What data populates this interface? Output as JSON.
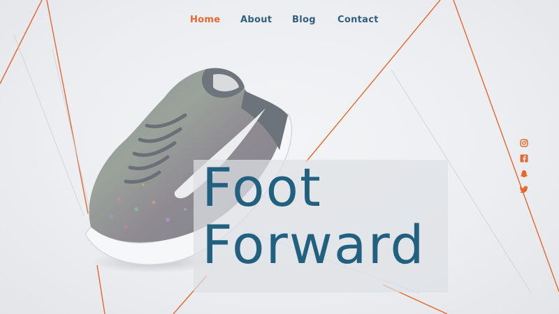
{
  "nav": {
    "items": [
      {
        "label": "Home",
        "active": true
      },
      {
        "label": "About",
        "active": false
      },
      {
        "label": "Blog",
        "active": false
      },
      {
        "label": "Contact",
        "active": false
      }
    ]
  },
  "hero": {
    "title_line1": "Foot",
    "title_line2": "Forward"
  },
  "social": [
    "instagram-icon",
    "facebook-icon",
    "snapchat-icon",
    "twitter-icon"
  ],
  "colors": {
    "accent": "#e8662f",
    "primary": "#22607f",
    "nav": "#2f5f7d",
    "background": "#eceef1"
  }
}
